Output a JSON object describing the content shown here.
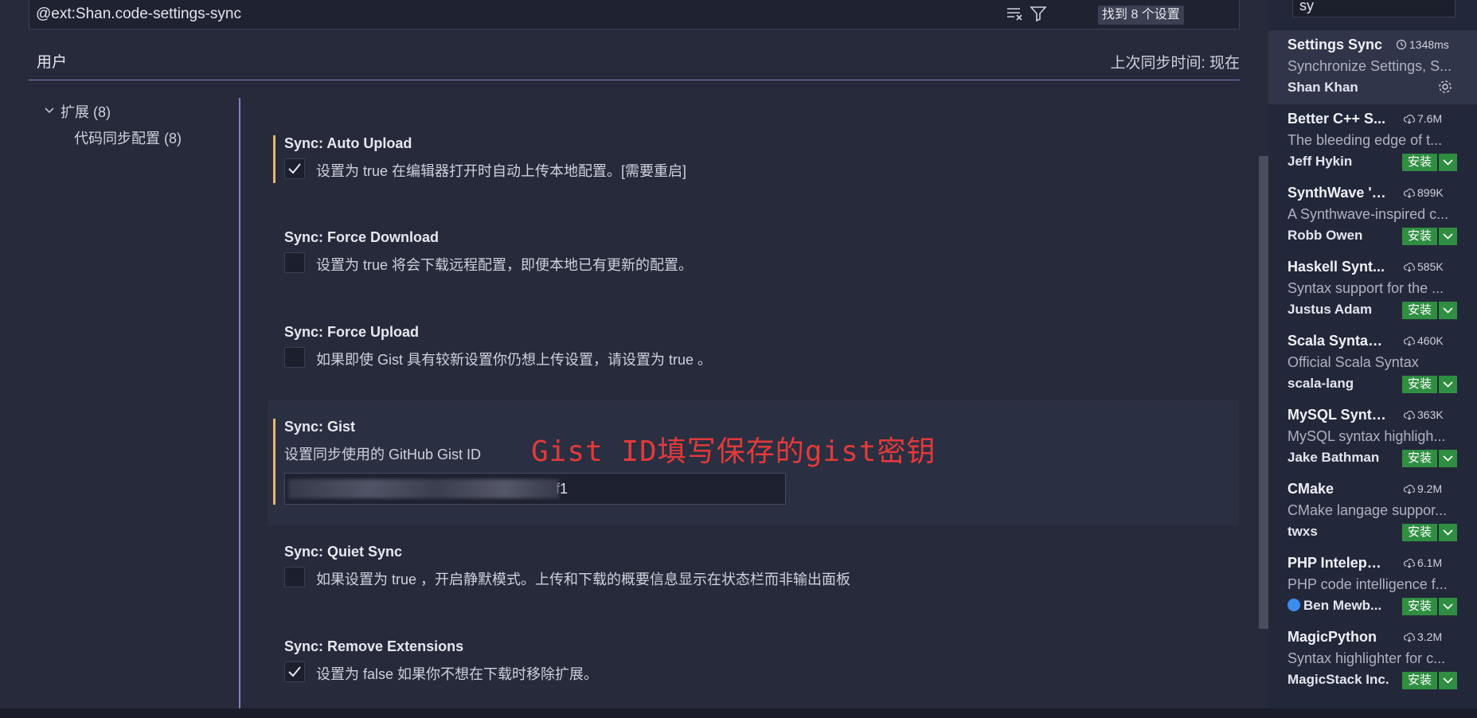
{
  "search": {
    "value": "@ext:Shan.code-settings-sync",
    "results": "找到 8 个设置"
  },
  "tabs": {
    "user": "用户",
    "last_sync": "上次同步时间: 现在"
  },
  "toc": {
    "extensions": "扩展 (8)",
    "sync_config": "代码同步配置 (8)"
  },
  "settings": [
    {
      "title": "Sync: Auto Upload",
      "desc": "设置为 true 在编辑器打开时自动上传本地配置。[需要重启]",
      "checked": true
    },
    {
      "title": "Sync: Force Download",
      "desc": "设置为 true 将会下载远程配置，即便本地已有更新的配置。",
      "checked": false
    },
    {
      "title": "Sync: Force Upload",
      "desc": "如果即使 Gist 具有较新设置你仍想上传设置，请设置为 true 。",
      "checked": false
    },
    {
      "title": "Sync: Gist",
      "desc": "设置同步使用的 GitHub Gist ID",
      "value": "f1"
    },
    {
      "title": "Sync: Quiet Sync",
      "desc": "如果设置为 true ，开启静默模式。上传和下载的概要信息显示在状态栏而非输出面板",
      "checked": false
    },
    {
      "title": "Sync: Remove Extensions",
      "desc": "设置为 false 如果你不想在下载时移除扩展。",
      "checked": true
    }
  ],
  "annotation": "Gist  ID填写保存的gist密钥",
  "extensions": {
    "search_value": "sy",
    "install_label": "安装",
    "items": [
      {
        "name": "Settings Sync",
        "stat": "1348ms",
        "desc": "Synchronize Settings, S...",
        "author": "Shan Khan"
      },
      {
        "name": "Better C++ S...",
        "stat": "7.6M",
        "desc": "The bleeding edge of t...",
        "author": "Jeff Hykin"
      },
      {
        "name": "SynthWave '84",
        "stat": "899K",
        "desc": "A Synthwave-inspired c...",
        "author": "Robb Owen"
      },
      {
        "name": "Haskell Synt...",
        "stat": "585K",
        "desc": "Syntax support for the ...",
        "author": "Justus Adam"
      },
      {
        "name": "Scala Syntax ...",
        "stat": "460K",
        "desc": "Official Scala Syntax",
        "author": "scala-lang"
      },
      {
        "name": "MySQL Syntax",
        "stat": "363K",
        "desc": "MySQL syntax highligh...",
        "author": "Jake Bathman"
      },
      {
        "name": "CMake",
        "stat": "9.2M",
        "desc": "CMake langage suppor...",
        "author": "twxs"
      },
      {
        "name": "PHP Inteleph...",
        "stat": "6.1M",
        "desc": "PHP code intelligence f...",
        "author": "Ben Mewb..."
      },
      {
        "name": "MagicPython",
        "stat": "3.2M",
        "desc": "Syntax highlighter for c...",
        "author": "MagicStack Inc."
      }
    ]
  },
  "colors": {
    "accent": "#8c79c5",
    "modified": "#e2b96e",
    "install": "#2f8e41",
    "annotation": "#e23a3a"
  }
}
